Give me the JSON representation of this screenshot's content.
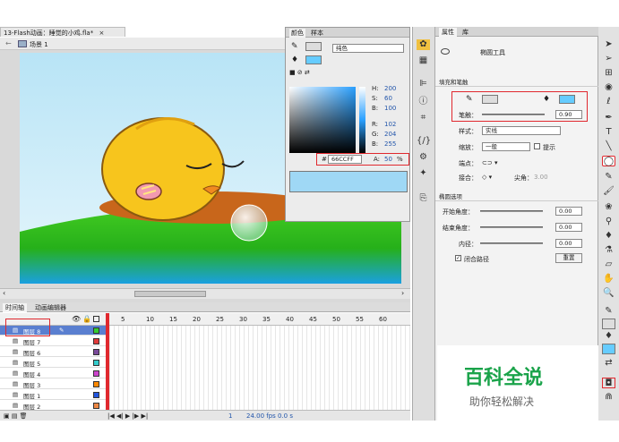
{
  "doc_tab": {
    "title": "13-Flash动画：睡觉的小鸡.fla*",
    "close": "×"
  },
  "stage_bar": {
    "scene_label": "场景 1"
  },
  "timeline": {
    "tabs": [
      "时间轴",
      "动画编辑器"
    ],
    "frame_numbers": [
      "5",
      "10",
      "15",
      "20",
      "25",
      "30",
      "35",
      "40",
      "45",
      "50",
      "55",
      "60"
    ],
    "layers": [
      {
        "name": "图层 8",
        "color": "#33cc33",
        "selected": true
      },
      {
        "name": "图层 7",
        "color": "#e03a3a"
      },
      {
        "name": "图层 6",
        "color": "#7a4a9a"
      },
      {
        "name": "图层 5",
        "color": "#33cccc"
      },
      {
        "name": "图层 4",
        "color": "#cc44cc"
      },
      {
        "name": "图层 3",
        "color": "#ff8800"
      },
      {
        "name": "图层 1",
        "color": "#2255dd"
      },
      {
        "name": "图层 2",
        "color": "#ee8844"
      }
    ],
    "footer": {
      "frame": "1",
      "fps": "24.00 fps",
      "time": "0.0 s"
    }
  },
  "color_panel": {
    "tabs": [
      "颜色",
      "样本"
    ],
    "type": "纯色",
    "hsb": {
      "h": "200",
      "s": "60",
      "b": "100"
    },
    "rgb": {
      "r": "102",
      "g": "204",
      "b": "255"
    },
    "hex": "66CCFF",
    "alpha": "50",
    "labels": {
      "h": "H:",
      "s": "S:",
      "b": "B:",
      "r": "R:",
      "g": "G:",
      "bl": "B:",
      "a": "A:",
      "hash": "#",
      "pct": "%",
      "deg": "°"
    }
  },
  "properties": {
    "tabs": [
      "属性",
      "库"
    ],
    "tool_name": "椭圆工具",
    "section_fill_stroke": "填充和笔触",
    "stroke_label": "笔触：",
    "stroke_value": "0.90",
    "style_label": "样式：",
    "style_value": "实线",
    "scale_label": "缩放：",
    "scale_value": "一般",
    "hint_label": "提示",
    "cap_label": "端点：",
    "join_label": "接合：",
    "miter_label": "尖角：",
    "miter_value": "3.00",
    "section_ellipse": "椭圆选项",
    "start_angle_label": "开始角度：",
    "start_angle_value": "0.00",
    "end_angle_label": "结束角度：",
    "end_angle_value": "0.00",
    "inner_radius_label": "内径：",
    "inner_radius_value": "0.00",
    "close_path_label": "闭合路径",
    "reset_label": "重置"
  },
  "watermark": {
    "title": "百科全说",
    "subtitle": "助你轻松解决"
  },
  "colors": {
    "fill": "#66CCFF",
    "accent_red": "#e0282e",
    "chick": "#f7c51d"
  }
}
